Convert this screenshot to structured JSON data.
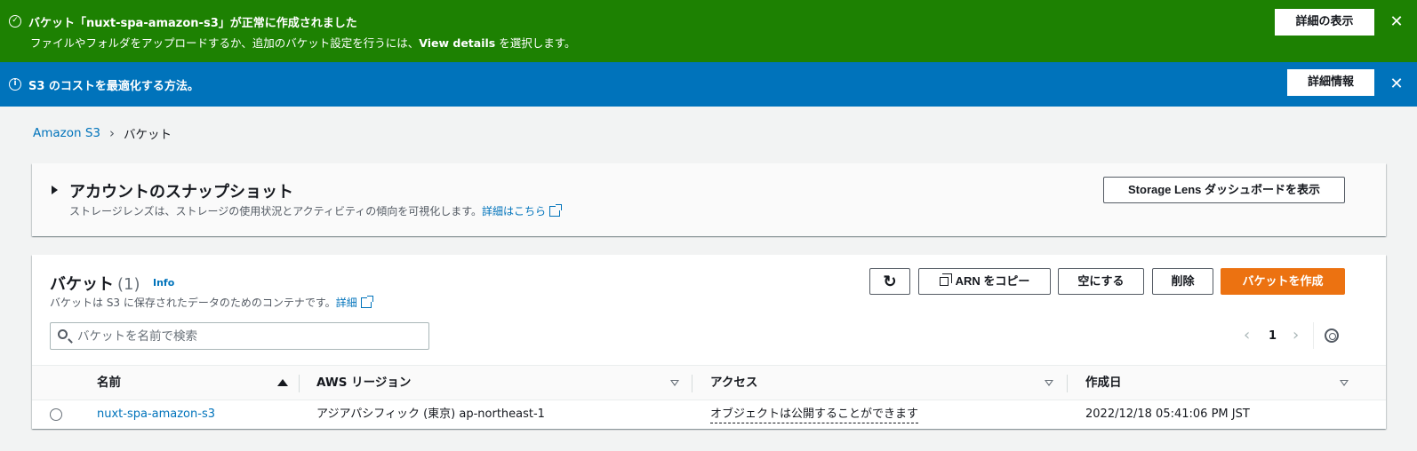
{
  "flash_success": {
    "title": "バケット「nuxt-spa-amazon-s3」が正常に作成されました",
    "body_prefix": "ファイルやフォルダをアップロードするか、追加のバケット設定を行うには、",
    "body_link": "View details",
    "body_suffix": " を選択します。",
    "button": "詳細の表示",
    "close": "✕",
    "icon": "✓"
  },
  "flash_info": {
    "title": "S3 のコストを最適化する方法。",
    "button": "詳細情報",
    "close": "✕",
    "icon": "i"
  },
  "breadcrumb": {
    "root": "Amazon S3",
    "separator": "›",
    "current": "バケット"
  },
  "snapshot": {
    "title": "アカウントのスナップショット",
    "description": "ストレージレンズは、ストレージの使用状況とアクティビティの傾向を可視化します。",
    "link": "詳細はこちら",
    "button": "Storage Lens ダッシュボードを表示"
  },
  "buckets": {
    "title": "バケット",
    "count": "(1)",
    "info": "Info",
    "description": "バケットは S3 に保存されたデータのためのコンテナです。",
    "link": "詳細",
    "refresh": "↻",
    "copy_arn": "ARN をコピー",
    "empty": "空にする",
    "delete": "削除",
    "create": "バケットを作成",
    "search_placeholder": "バケットを名前で検索",
    "page": "1",
    "prev": "‹",
    "next": "›",
    "columns": [
      "名前",
      "AWS リージョン",
      "アクセス",
      "作成日"
    ],
    "rows": [
      {
        "name": "nuxt-spa-amazon-s3",
        "region": "アジアパシフィック (東京) ap-northeast-1",
        "access": "オブジェクトは公開することができます",
        "created": "2022/12/18 05:41:06 PM JST"
      }
    ]
  },
  "colors": {
    "success": "#1d8102",
    "info": "#0073bb",
    "primary": "#ec7211",
    "link": "#0073bb"
  }
}
